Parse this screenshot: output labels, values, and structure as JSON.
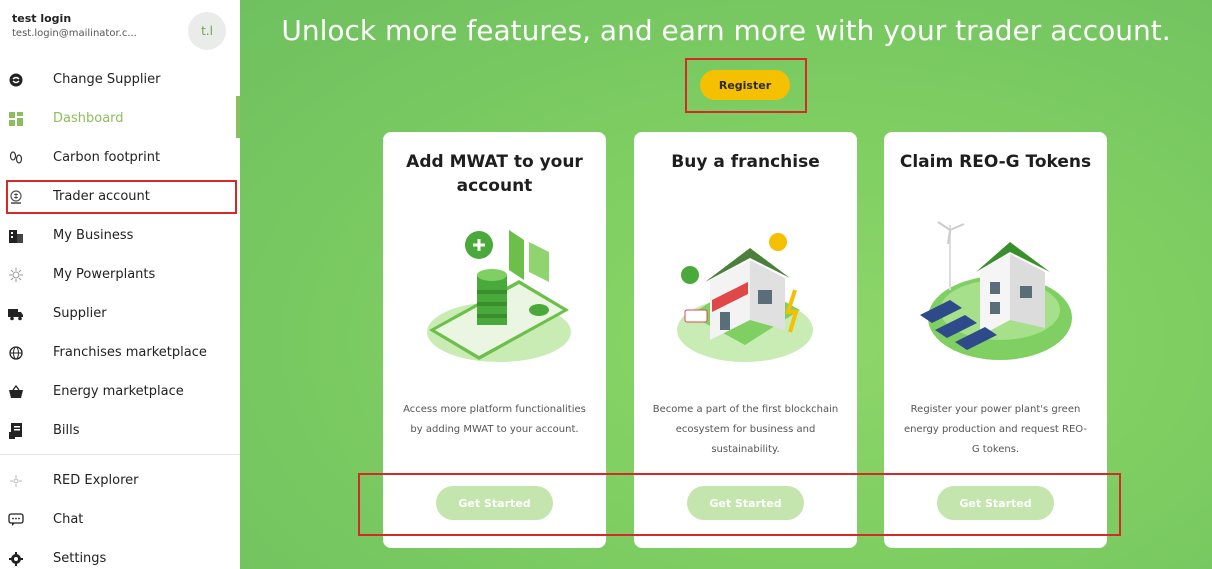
{
  "user": {
    "name": "test login",
    "email": "test.login@mailinator.c...",
    "initials": "t.l"
  },
  "sidebar": {
    "items": [
      {
        "label": "Change Supplier",
        "icon": "supplier-switch-icon",
        "active": false
      },
      {
        "label": "Dashboard",
        "icon": "dashboard-icon",
        "active": true
      },
      {
        "label": "Carbon footprint",
        "icon": "footprint-icon",
        "active": false
      },
      {
        "label": "Trader account",
        "icon": "trader-icon",
        "active": false
      },
      {
        "label": "My Business",
        "icon": "business-icon",
        "active": false
      },
      {
        "label": "My Powerplants",
        "icon": "powerplant-icon",
        "active": false
      },
      {
        "label": "Supplier",
        "icon": "truck-icon",
        "active": false
      },
      {
        "label": "Franchises marketplace",
        "icon": "globe-icon",
        "active": false
      },
      {
        "label": "Energy marketplace",
        "icon": "basket-icon",
        "active": false
      },
      {
        "label": "Bills",
        "icon": "bill-icon",
        "active": false
      }
    ],
    "secondary": [
      {
        "label": "RED Explorer",
        "icon": "explorer-icon"
      },
      {
        "label": "Chat",
        "icon": "chat-icon"
      },
      {
        "label": "Settings",
        "icon": "gear-icon"
      }
    ]
  },
  "main": {
    "headline": "Unlock more features, and earn more with your trader account.",
    "register_label": "Register",
    "cards": [
      {
        "title": "Add MWAT to your account",
        "description": "Access more platform functionalities by adding MWAT to your account.",
        "cta": "Get Started",
        "illustration": "mwat-phone-coins-illustration"
      },
      {
        "title": "Buy a franchise",
        "description": "Become a part of the first blockchain ecosystem for business and sustainability.",
        "cta": "Get Started",
        "illustration": "franchise-house-illustration"
      },
      {
        "title": "Claim REO-G Tokens",
        "description": "Register your power plant's green energy production and request REO-G tokens.",
        "cta": "Get Started",
        "illustration": "green-house-solar-illustration"
      }
    ]
  },
  "colors": {
    "accent_green": "#8bbf5b",
    "main_bg_green": "#7fcf62",
    "register_yellow": "#f5c000",
    "cta_light_green": "#c4e5ae",
    "highlight_red": "#d62a2a"
  }
}
